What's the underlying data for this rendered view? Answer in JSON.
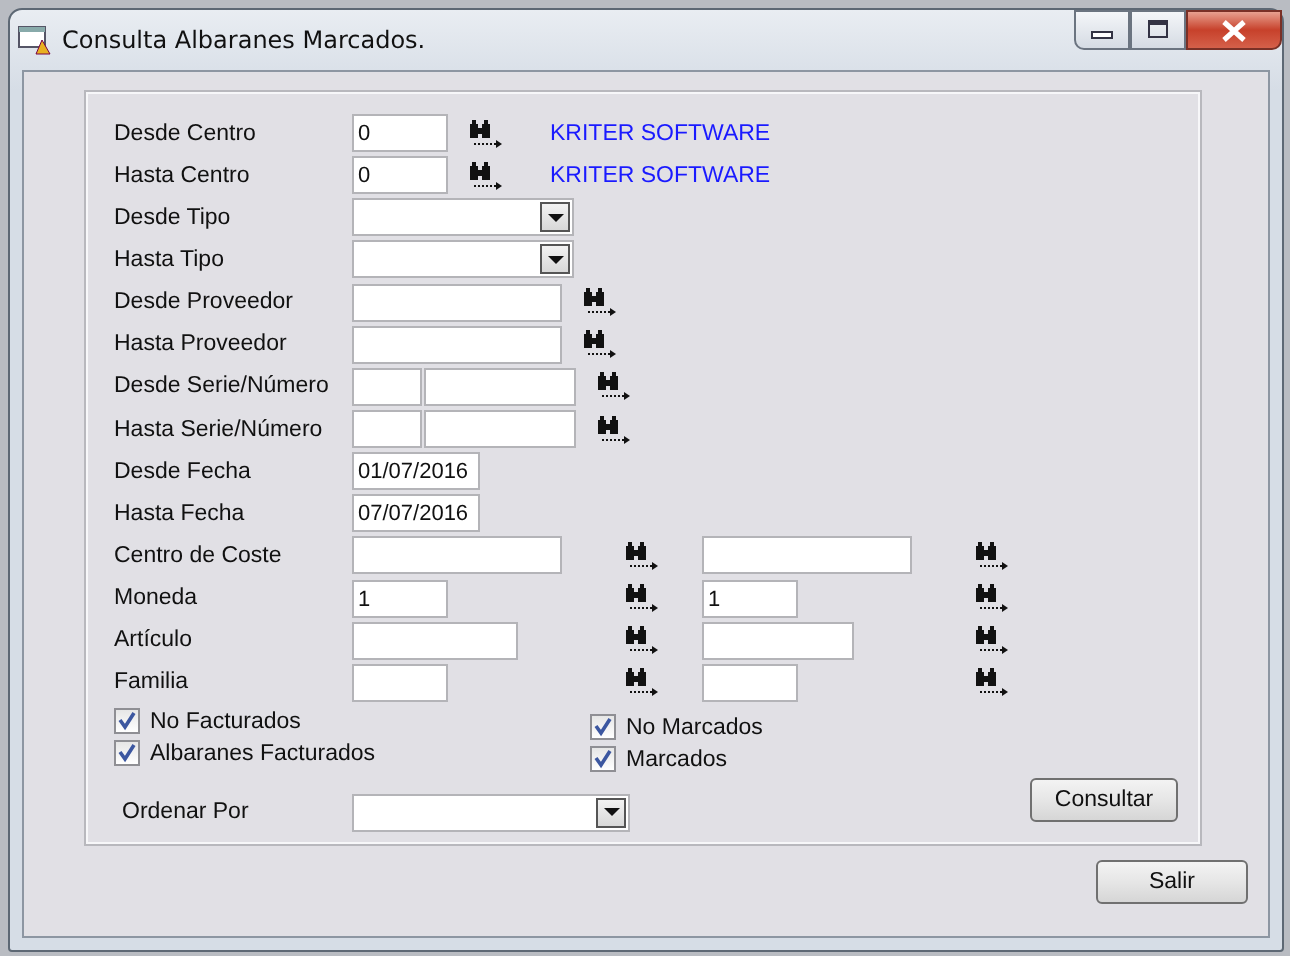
{
  "window": {
    "title": "Consulta Albaranes Marcados."
  },
  "rows": [
    {
      "kind": "single",
      "label": "Desde Centro",
      "fields": [
        {
          "kind": "text",
          "value": "0",
          "search": true
        }
      ],
      "note": "KRITER SOFTWARE"
    },
    {
      "kind": "single",
      "label": "Hasta Centro",
      "fields": [
        {
          "kind": "text",
          "value": "0",
          "search": true
        }
      ],
      "note": "KRITER SOFTWARE"
    },
    {
      "kind": "single",
      "label": "Desde Tipo",
      "fields": [
        {
          "kind": "combo",
          "search": false
        }
      ]
    },
    {
      "kind": "single",
      "label": "Hasta Tipo",
      "fields": [
        {
          "kind": "combo",
          "search": false
        }
      ]
    },
    {
      "kind": "single",
      "label": "Desde Proveedor",
      "fields": [
        {
          "kind": "text",
          "search": true
        }
      ]
    },
    {
      "kind": "single",
      "label": "Hasta Proveedor",
      "fields": [
        {
          "kind": "text",
          "search": true
        }
      ]
    },
    {
      "kind": "split",
      "label": "Desde Serie/Número",
      "fields": [
        {
          "kind": "text",
          "search": false
        },
        {
          "kind": "text",
          "search": true
        }
      ]
    },
    {
      "kind": "split",
      "label": "Hasta Serie/Número",
      "fields": [
        {
          "kind": "text",
          "search": false
        },
        {
          "kind": "text",
          "search": true
        }
      ]
    },
    {
      "kind": "single",
      "label": "Desde Fecha",
      "fields": [
        {
          "kind": "text",
          "value": "01/07/2016",
          "search": false
        }
      ]
    },
    {
      "kind": "single",
      "label": "Hasta Fecha",
      "fields": [
        {
          "kind": "text",
          "value": "07/07/2016",
          "search": false
        }
      ]
    },
    {
      "kind": "pair",
      "label": "Centro de Coste",
      "fields": [
        {
          "kind": "text",
          "search": true
        },
        {
          "kind": "text",
          "search": true
        }
      ]
    },
    {
      "kind": "pair",
      "label": "Moneda",
      "fields": [
        {
          "kind": "text",
          "value": "1",
          "search": true
        },
        {
          "kind": "text",
          "value": "1",
          "search": true
        }
      ]
    },
    {
      "kind": "pair",
      "label": "Artículo",
      "fields": [
        {
          "kind": "text",
          "search": true
        },
        {
          "kind": "text",
          "search": true
        }
      ]
    },
    {
      "kind": "pair",
      "label": "Familia",
      "fields": [
        {
          "kind": "text",
          "search": true
        },
        {
          "kind": "text",
          "search": true
        }
      ]
    }
  ],
  "checkboxes_left": [
    {
      "label": "No Facturados",
      "checked": true
    },
    {
      "label": "Albaranes Facturados",
      "checked": true
    }
  ],
  "checkboxes_right": [
    {
      "label": "No Marcados",
      "checked": true
    },
    {
      "label": "Marcados",
      "checked": true
    }
  ],
  "sort": {
    "label": "Ordenar Por"
  },
  "buttons": {
    "query": "Consultar",
    "exit": "Salir"
  }
}
